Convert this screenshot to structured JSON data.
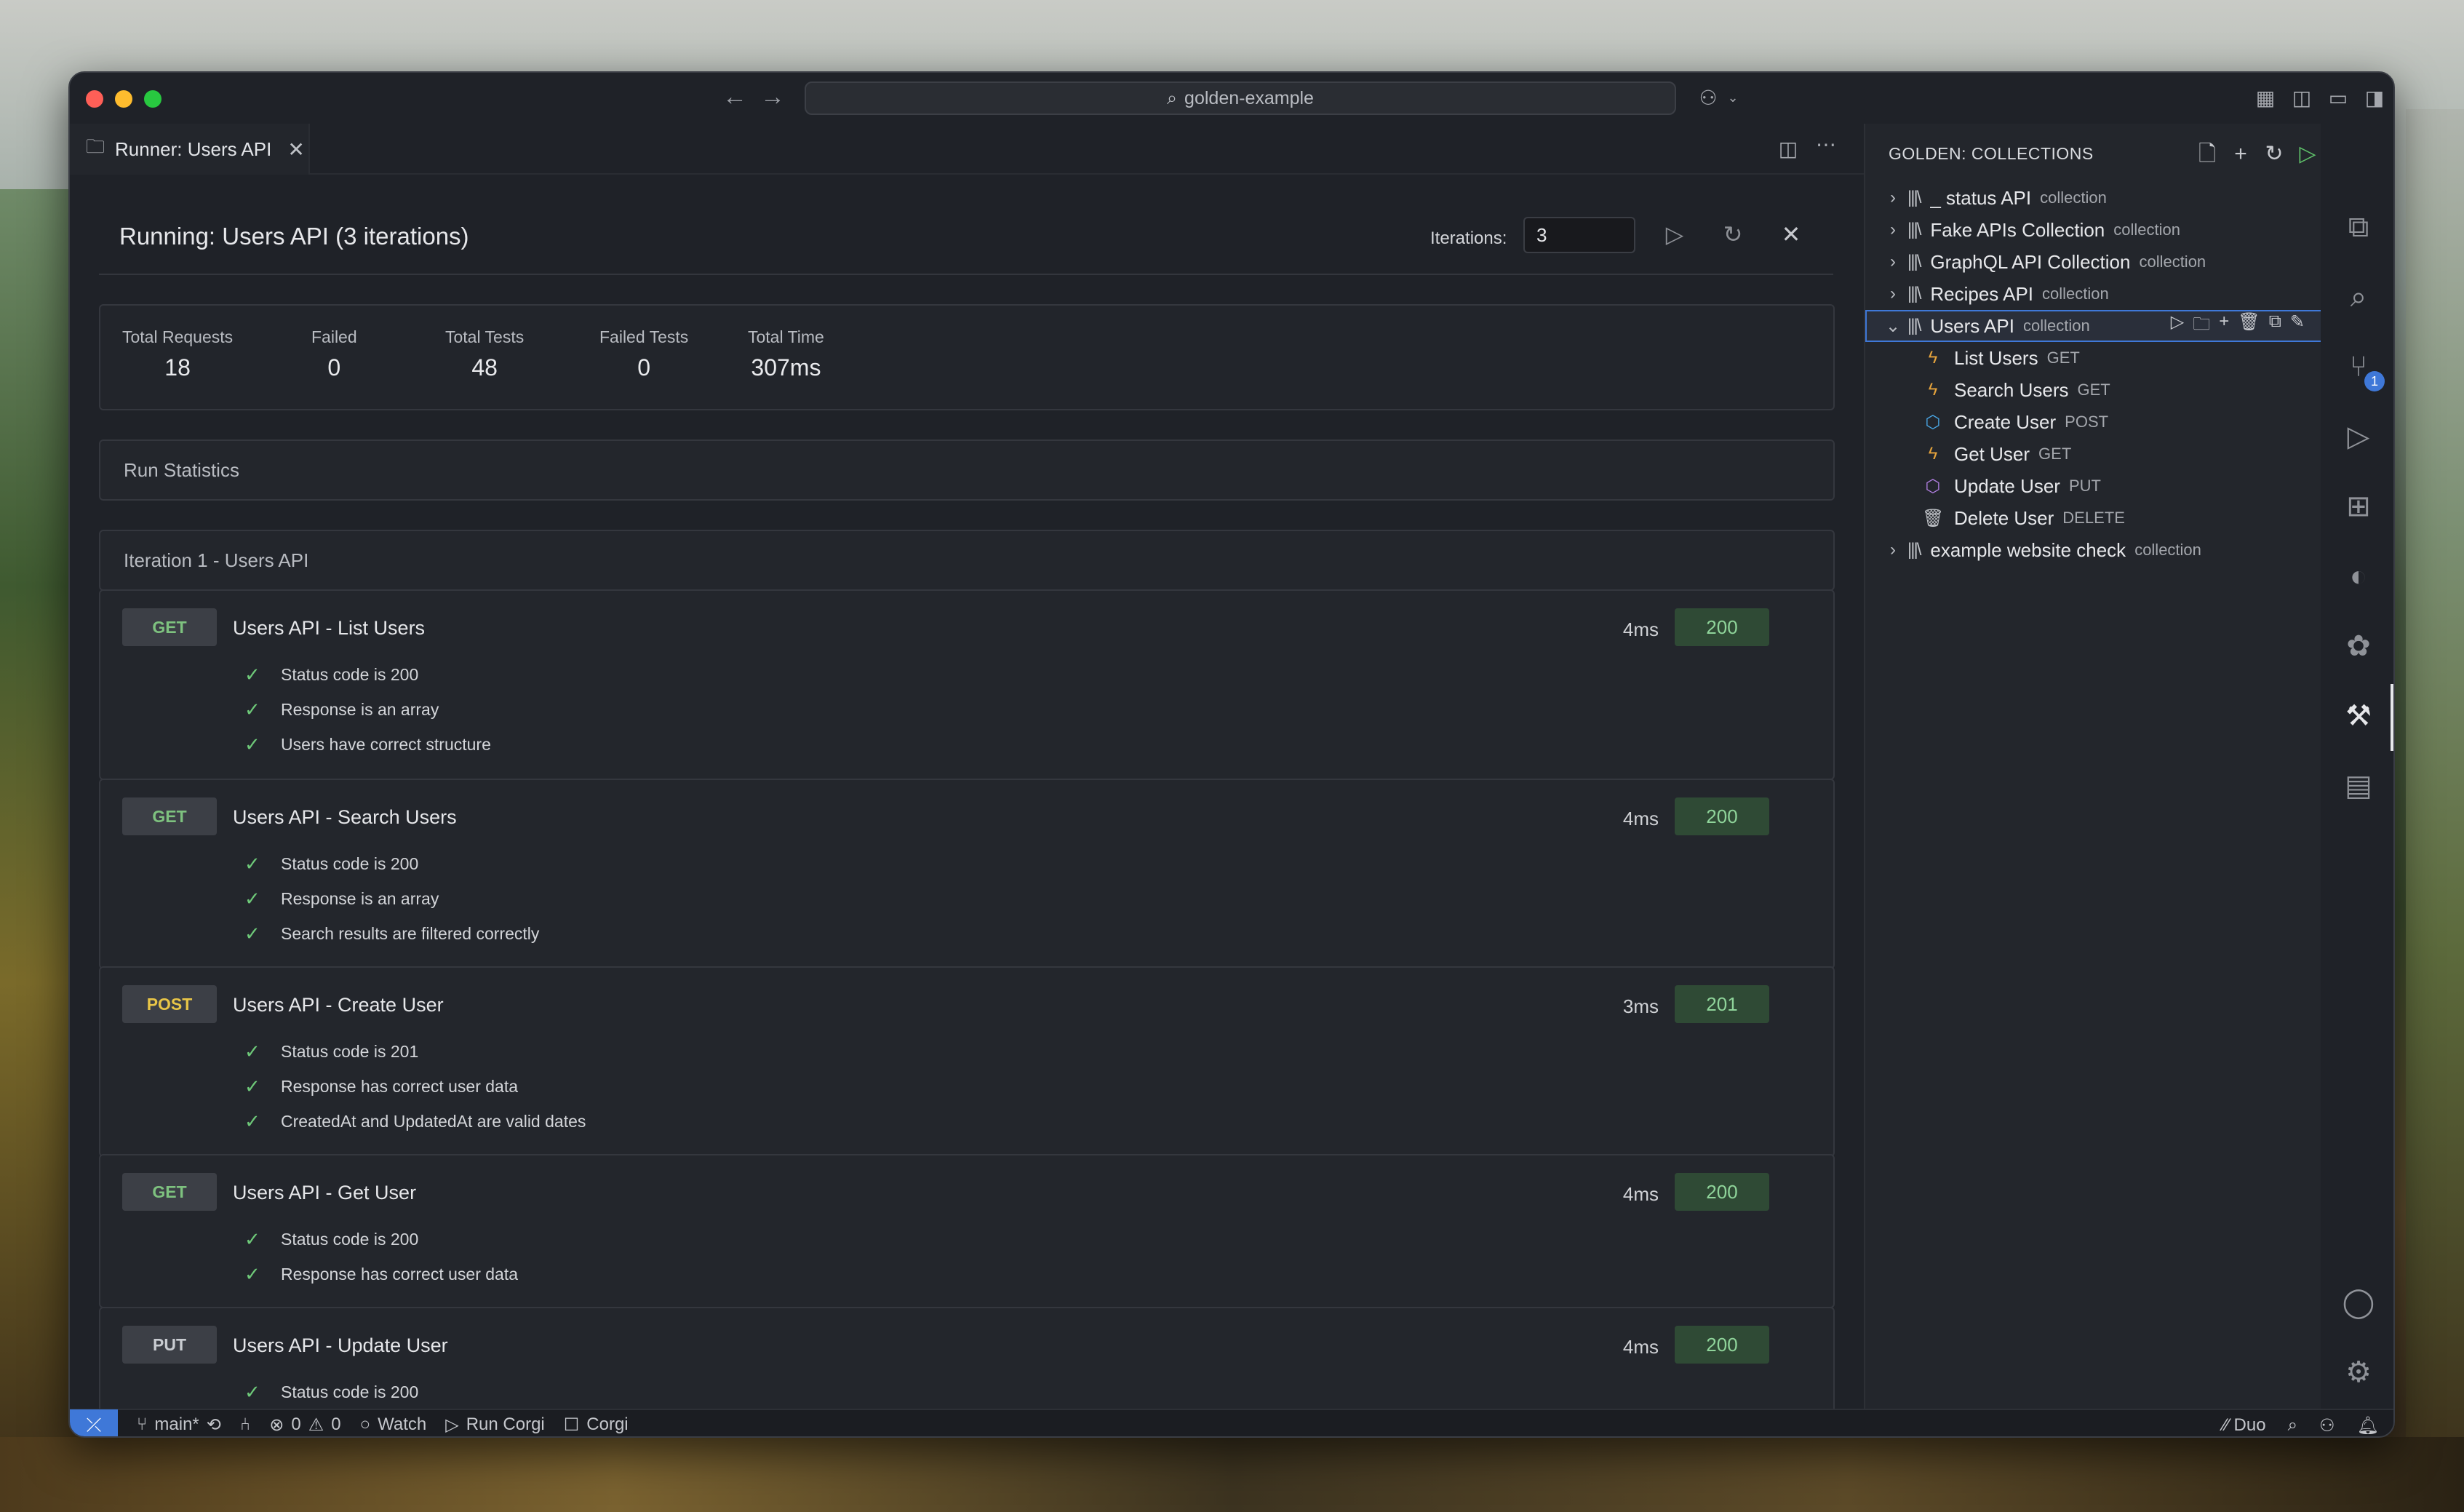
{
  "titlebar": {
    "search_text": "golden-example"
  },
  "tab": {
    "label": "Runner: Users API",
    "close": "✕"
  },
  "runner": {
    "title": "Running:  Users API (3 iterations)",
    "iterations_label": "Iterations:",
    "iterations_value": "3"
  },
  "summary": [
    {
      "label": "Total Requests",
      "value": "18"
    },
    {
      "label": "Failed",
      "value": "0"
    },
    {
      "label": "Total Tests",
      "value": "48"
    },
    {
      "label": "Failed Tests",
      "value": "0"
    },
    {
      "label": "Total Time",
      "value": "307ms"
    }
  ],
  "sections": {
    "run_statistics": "Run Statistics",
    "iteration": "Iteration 1 - Users API"
  },
  "requests": [
    {
      "method": "GET",
      "name": "Users API - List Users",
      "time": "4ms",
      "status": "200",
      "tests": [
        "Status code is 200",
        "Response is an array",
        "Users have correct structure"
      ]
    },
    {
      "method": "GET",
      "name": "Users API - Search Users",
      "time": "4ms",
      "status": "200",
      "tests": [
        "Status code is 200",
        "Response is an array",
        "Search results are filtered correctly"
      ]
    },
    {
      "method": "POST",
      "name": "Users API - Create User",
      "time": "3ms",
      "status": "201",
      "tests": [
        "Status code is 201",
        "Response has correct user data",
        "CreatedAt and UpdatedAt are valid dates"
      ]
    },
    {
      "method": "GET",
      "name": "Users API - Get User",
      "time": "4ms",
      "status": "200",
      "tests": [
        "Status code is 200",
        "Response has correct user data"
      ]
    },
    {
      "method": "PUT",
      "name": "Users API - Update User",
      "time": "4ms",
      "status": "200",
      "tests": [
        "Status code is 200"
      ]
    }
  ],
  "panel": {
    "title": "GOLDEN: COLLECTIONS",
    "collections": [
      {
        "name": "_ status API",
        "tag": "collection"
      },
      {
        "name": "Fake APIs Collection",
        "tag": "collection"
      },
      {
        "name": "GraphQL API Collection",
        "tag": "collection"
      },
      {
        "name": "Recipes API",
        "tag": "collection"
      },
      {
        "name": "Users API",
        "tag": "collection"
      },
      {
        "name": "example website check",
        "tag": "collection"
      }
    ],
    "users_children": [
      {
        "name": "List Users",
        "method": "GET"
      },
      {
        "name": "Search Users",
        "method": "GET"
      },
      {
        "name": "Create User",
        "method": "POST"
      },
      {
        "name": "Get User",
        "method": "GET"
      },
      {
        "name": "Update User",
        "method": "PUT"
      },
      {
        "name": "Delete User",
        "method": "DELETE"
      }
    ]
  },
  "activity_badge": "1",
  "statusbar": {
    "branch": "main*",
    "errors": "0",
    "warnings": "0",
    "watch": "Watch",
    "run_corgi": "Run Corgi",
    "corgi": "Corgi",
    "duo": "Duo"
  }
}
